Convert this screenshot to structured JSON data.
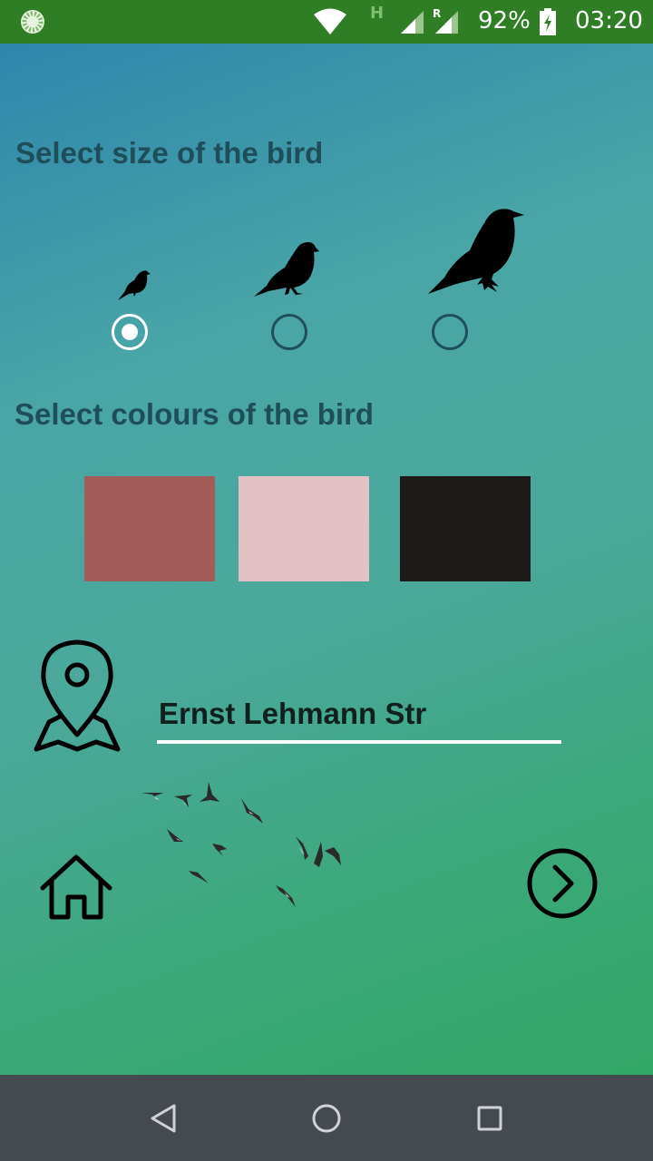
{
  "status_bar": {
    "network_type": "H",
    "roaming": "R",
    "battery_percent": "92%",
    "time": "03:20",
    "icons": [
      "app-notification-icon",
      "wifi-icon",
      "signal-icon",
      "signal-roaming-icon",
      "battery-charging-icon"
    ]
  },
  "size_section": {
    "title": "Select size of the bird",
    "options": [
      {
        "label": "small",
        "icon": "small-bird-icon",
        "selected": true
      },
      {
        "label": "medium",
        "icon": "medium-bird-icon",
        "selected": false
      },
      {
        "label": "large",
        "icon": "large-bird-icon",
        "selected": false
      }
    ]
  },
  "colour_section": {
    "title": "Select colours of the bird",
    "swatches": [
      "#a35d59",
      "#e2c2c4",
      "#1e1a1a"
    ]
  },
  "location": {
    "value": "Ernst Lehmann Str",
    "icon": "map-pin-icon"
  },
  "bottom_actions": {
    "home_icon": "home-icon",
    "next_icon": "chevron-right-circle-icon",
    "decoration": "bird-flock-image"
  },
  "nav_bar": {
    "icons": [
      "back-triangle-icon",
      "home-circle-icon",
      "recents-square-icon"
    ]
  },
  "colors": {
    "status_bar": "#2f7d24",
    "title_text": "#1e4e5a",
    "nav_bar": "#454a50"
  }
}
